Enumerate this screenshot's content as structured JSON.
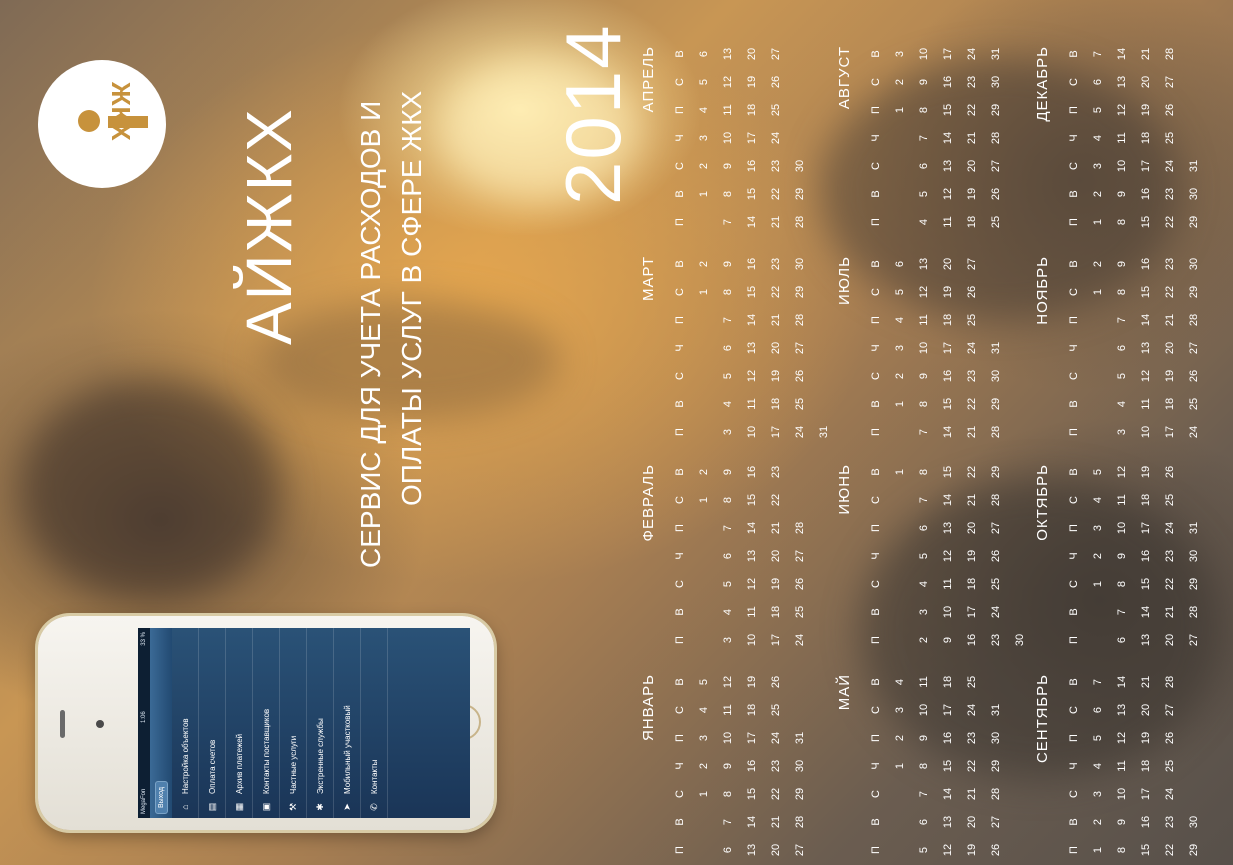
{
  "brand": {
    "logo_text": "ЖКХ",
    "name": "АЙЖКХ",
    "tagline_line1": "СЕРВИС ДЛЯ УЧЕТА РАСХОДОВ И",
    "tagline_line2": "ОПЛАТЫ УСЛУГ В СФЕРЕ ЖКХ"
  },
  "calendar": {
    "year": "2014",
    "weekdays": [
      "П",
      "В",
      "С",
      "Ч",
      "П",
      "С",
      "В"
    ],
    "months": [
      {
        "name": "ЯНВАРЬ",
        "offset": 2,
        "days": 31
      },
      {
        "name": "ФЕВРАЛЬ",
        "offset": 5,
        "days": 28
      },
      {
        "name": "МАРТ",
        "offset": 5,
        "days": 31
      },
      {
        "name": "АПРЕЛЬ",
        "offset": 1,
        "days": 30
      },
      {
        "name": "МАЙ",
        "offset": 3,
        "days": 31
      },
      {
        "name": "ИЮНЬ",
        "offset": 6,
        "days": 30
      },
      {
        "name": "ИЮЛЬ",
        "offset": 1,
        "days": 31
      },
      {
        "name": "АВГУСТ",
        "offset": 4,
        "days": 31
      },
      {
        "name": "СЕНТЯБРЬ",
        "offset": 0,
        "days": 30
      },
      {
        "name": "ОКТЯБРЬ",
        "offset": 2,
        "days": 31
      },
      {
        "name": "НОЯБРЬ",
        "offset": 5,
        "days": 30
      },
      {
        "name": "ДЕКАБРЬ",
        "offset": 0,
        "days": 31
      }
    ]
  },
  "phone": {
    "status_carrier": "MegaFon",
    "status_time": "1:06",
    "status_battery": "33 %",
    "nav_left_button": "Выход",
    "nav_right_button": "Меню",
    "menu_items": [
      {
        "label": "Настройка объектов",
        "icon": "house-settings-icon"
      },
      {
        "label": "Оплата счетов",
        "icon": "bill-icon"
      },
      {
        "label": "Архив платежей",
        "icon": "archive-icon"
      },
      {
        "label": "Контакты поставщиков",
        "icon": "contacts-icon"
      },
      {
        "label": "Частные услуги",
        "icon": "worker-icon"
      },
      {
        "label": "Экстренные службы",
        "icon": "emergency-icon"
      },
      {
        "label": "Мобильный участковый",
        "icon": "location-arrow-icon"
      },
      {
        "label": "Контакты",
        "icon": "phone-icon"
      }
    ]
  },
  "colors": {
    "logo_accent": "#c7923c",
    "text": "#ffffff"
  }
}
